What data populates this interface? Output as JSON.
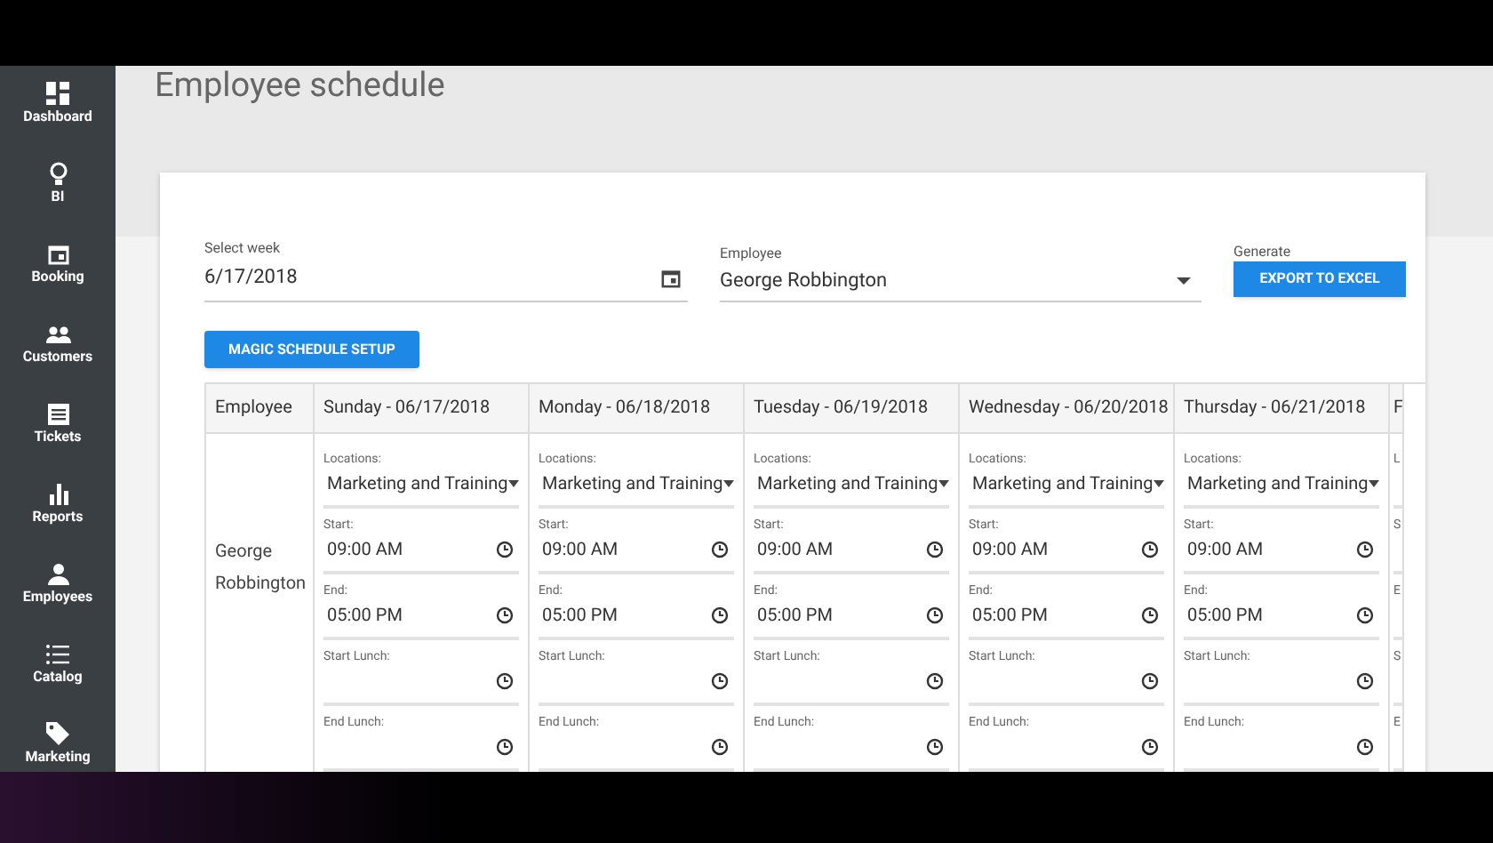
{
  "sidebar": {
    "items": [
      {
        "label": "Dashboard"
      },
      {
        "label": "BI"
      },
      {
        "label": "Booking"
      },
      {
        "label": "Customers"
      },
      {
        "label": "Tickets"
      },
      {
        "label": "Reports"
      },
      {
        "label": "Employees"
      },
      {
        "label": "Catalog"
      },
      {
        "label": "Marketing"
      }
    ]
  },
  "page_title": "Employee schedule",
  "filters": {
    "week": {
      "label": "Select week",
      "value": "6/17/2018"
    },
    "employee": {
      "label": "Employee",
      "value": "George Robbington"
    },
    "generate": {
      "label": "Generate",
      "button": "EXPORT TO EXCEL"
    }
  },
  "magic_button": "MAGIC SCHEDULE SETUP",
  "table": {
    "employee_header": "Employee",
    "employee_name": "George Robbington",
    "days": [
      {
        "kind": "full",
        "header": "Sunday - 06/17/2018",
        "fields": [
          {
            "kind": "select",
            "label": "Locations:",
            "value": "Marketing and Training"
          },
          {
            "kind": "time",
            "label": "Start:",
            "value": "09:00 AM"
          },
          {
            "kind": "time",
            "label": "End:",
            "value": "05:00 PM"
          },
          {
            "kind": "time",
            "label": "Start Lunch:"
          },
          {
            "kind": "time",
            "label": "End Lunch:"
          }
        ]
      },
      {
        "kind": "full",
        "header": "Monday - 06/18/2018",
        "fields": [
          {
            "kind": "select",
            "label": "Locations:",
            "value": "Marketing and Training"
          },
          {
            "kind": "time",
            "label": "Start:",
            "value": "09:00 AM"
          },
          {
            "kind": "time",
            "label": "End:",
            "value": "05:00 PM"
          },
          {
            "kind": "time",
            "label": "Start Lunch:"
          },
          {
            "kind": "time",
            "label": "End Lunch:"
          }
        ]
      },
      {
        "kind": "full",
        "header": "Tuesday - 06/19/2018",
        "fields": [
          {
            "kind": "select",
            "label": "Locations:",
            "value": "Marketing and Training"
          },
          {
            "kind": "time",
            "label": "Start:",
            "value": "09:00 AM"
          },
          {
            "kind": "time",
            "label": "End:",
            "value": "05:00 PM"
          },
          {
            "kind": "time",
            "label": "Start Lunch:"
          },
          {
            "kind": "time",
            "label": "End Lunch:"
          }
        ]
      },
      {
        "kind": "full",
        "header": "Wednesday - 06/20/2018",
        "fields": [
          {
            "kind": "select",
            "label": "Locations:",
            "value": "Marketing and Training"
          },
          {
            "kind": "time",
            "label": "Start:",
            "value": "09:00 AM"
          },
          {
            "kind": "time",
            "label": "End:",
            "value": "05:00 PM"
          },
          {
            "kind": "time",
            "label": "Start Lunch:"
          },
          {
            "kind": "time",
            "label": "End Lunch:"
          }
        ]
      },
      {
        "kind": "full",
        "header": "Thursday - 06/21/2018",
        "fields": [
          {
            "kind": "select",
            "label": "Locations:",
            "value": "Marketing and Training"
          },
          {
            "kind": "time",
            "label": "Start:",
            "value": "09:00 AM"
          },
          {
            "kind": "time",
            "label": "End:",
            "value": "05:00 PM"
          },
          {
            "kind": "time",
            "label": "Start Lunch:"
          },
          {
            "kind": "time",
            "label": "End Lunch:"
          }
        ]
      },
      {
        "kind": "partial",
        "header": "F",
        "fields": [
          {
            "kind": "select",
            "label": "L"
          },
          {
            "kind": "time",
            "label": "S"
          },
          {
            "kind": "time",
            "label": "E"
          },
          {
            "kind": "time",
            "label": "S"
          },
          {
            "kind": "time",
            "label": "E"
          }
        ]
      }
    ]
  }
}
